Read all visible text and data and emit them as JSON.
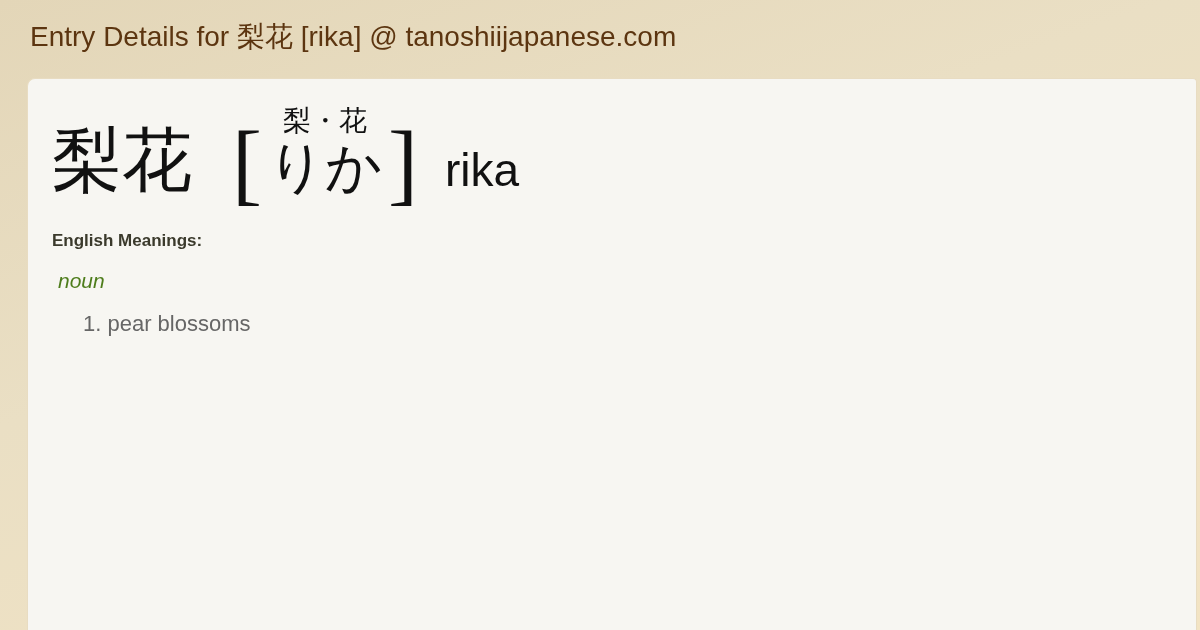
{
  "page_title": "Entry Details for 梨花 [rika] @ tanoshiijapanese.com",
  "entry": {
    "headword": "梨花",
    "reading": {
      "open_bracket": "[",
      "furigana": "梨・花",
      "kana": "りか",
      "close_bracket": "]"
    },
    "romaji": "rika"
  },
  "meanings": {
    "heading": "English Meanings:",
    "groups": [
      {
        "part_of_speech": "noun",
        "senses": [
          {
            "number": "1.",
            "text": "pear blossoms"
          }
        ]
      }
    ]
  }
}
